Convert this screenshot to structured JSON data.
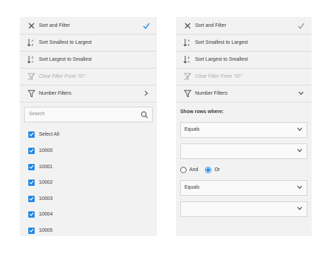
{
  "left_panel": {
    "header": {
      "title": "Sort and Filter",
      "close_icon": "close-icon",
      "confirm_icon": "checkmark-icon",
      "accent": "#1e88e5"
    },
    "menu": [
      {
        "label": "Sort Smallest to Largest",
        "icon": "sort-ascending-icon",
        "disabled": false
      },
      {
        "label": "Sort Largest to Smallest",
        "icon": "sort-descending-icon",
        "disabled": false
      },
      {
        "label": "Clear Filter From \"ID\"",
        "icon": "clear-filter-icon",
        "disabled": true
      },
      {
        "label": "Number Filters",
        "icon": "filter-icon",
        "disabled": false,
        "trailing_icon": "chevron-right-icon"
      }
    ],
    "search": {
      "placeholder": "Search",
      "icon": "search-icon"
    },
    "items": [
      {
        "label": "Select All",
        "checked": true
      },
      {
        "label": "10000",
        "checked": true
      },
      {
        "label": "10001",
        "checked": true
      },
      {
        "label": "10002",
        "checked": true
      },
      {
        "label": "10003",
        "checked": true
      },
      {
        "label": "10004",
        "checked": true
      },
      {
        "label": "10005",
        "checked": true
      }
    ]
  },
  "right_panel": {
    "header": {
      "title": "Sort and Filter",
      "close_icon": "close-icon",
      "confirm_icon": "checkmark-icon",
      "confirm_color": "#999999"
    },
    "menu": [
      {
        "label": "Sort Smallest to Largest",
        "icon": "sort-ascending-icon",
        "disabled": false
      },
      {
        "label": "Sort Largest to Smallest",
        "icon": "sort-descending-icon",
        "disabled": false
      },
      {
        "label": "Clear Filter From \"ID\"",
        "icon": "clear-filter-icon",
        "disabled": true
      },
      {
        "label": "Number Filters",
        "icon": "filter-icon",
        "disabled": false,
        "trailing_icon": "chevron-down-icon"
      }
    ],
    "show_rows_label": "Show rows where:",
    "condition1": {
      "operator": "Equals",
      "value": ""
    },
    "logic": {
      "and_label": "And",
      "or_label": "Or",
      "selected": "Or"
    },
    "condition2": {
      "operator": "Equals",
      "value": ""
    }
  }
}
